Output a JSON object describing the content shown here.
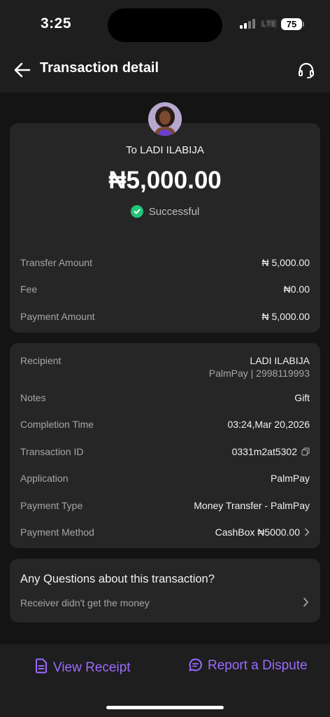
{
  "status_bar": {
    "time": "3:25",
    "network": "LTE",
    "battery": "75"
  },
  "header": {
    "title": "Transaction detail",
    "back_icon": "arrow-left-icon",
    "support_icon": "headset-icon"
  },
  "summary": {
    "recipient_line": "To LADI ILABIJA",
    "amount": "₦5,000.00",
    "status": "Successful",
    "status_color": "#22c47a",
    "rows": [
      {
        "label": "Transfer Amount",
        "value": "₦ 5,000.00"
      },
      {
        "label": "Fee",
        "value": "₦0.00"
      },
      {
        "label": "Payment Amount",
        "value": "₦ 5,000.00"
      }
    ]
  },
  "details": {
    "recipient": {
      "label": "Recipient",
      "value": "LADI ILABIJA",
      "sub": "PalmPay | 2998119993"
    },
    "notes": {
      "label": "Notes",
      "value": "Gift"
    },
    "completion_time": {
      "label": "Completion Time",
      "value": "03:24,Mar 20,2026"
    },
    "transaction_id": {
      "label": "Transaction ID",
      "value": "0331m2at5302"
    },
    "application": {
      "label": "Application",
      "value": "PalmPay"
    },
    "payment_type": {
      "label": "Payment Type",
      "value": "Money Transfer - PalmPay"
    },
    "payment_method": {
      "label": "Payment Method",
      "value": "CashBox ₦5000.00"
    }
  },
  "help": {
    "title": "Any Questions about this transaction?",
    "item": "Receiver didn't get the money"
  },
  "actions": {
    "view_receipt": "View Receipt",
    "report_dispute": "Report a Dispute",
    "accent_color": "#9b6bff"
  }
}
